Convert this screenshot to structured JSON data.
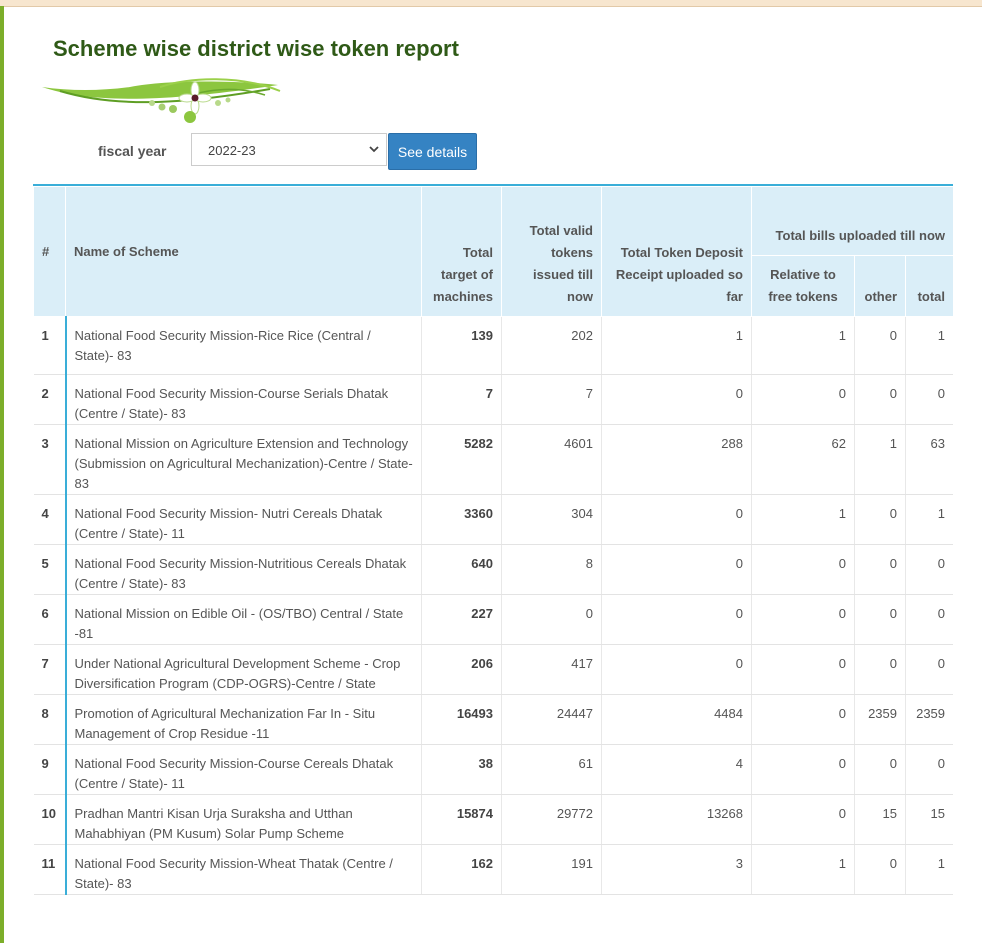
{
  "page": {
    "title": "Scheme wise district wise token report"
  },
  "filter": {
    "label": "fiscal year",
    "selected": "2022-23",
    "button_label": "See details"
  },
  "table": {
    "headers": {
      "index": "#",
      "name": "Name of Scheme",
      "target": "Total target of machines",
      "valid_tokens": "Total valid tokens issued till now",
      "deposit": "Total Token Deposit Receipt uploaded so far",
      "bills_group": "Total bills uploaded till now",
      "relative": "Relative to free tokens",
      "other": "other",
      "total": "total"
    },
    "rows": [
      {
        "idx": "1",
        "name": "National Food Security Mission-Rice Rice (Central / State)- 83",
        "target": "139",
        "valid": "202",
        "deposit": "1",
        "relative": "1",
        "other": "0",
        "total": "1"
      },
      {
        "idx": "2",
        "name": "National Food Security Mission-Course Serials Dhatak (Centre / State)- 83",
        "target": "7",
        "valid": "7",
        "deposit": "0",
        "relative": "0",
        "other": "0",
        "total": "0"
      },
      {
        "idx": "3",
        "name": "National Mission on Agriculture Extension and Technology (Submission on Agricultural Mechanization)-Centre / State- 83",
        "target": "5282",
        "valid": "4601",
        "deposit": "288",
        "relative": "62",
        "other": "1",
        "total": "63"
      },
      {
        "idx": "4",
        "name": "National Food Security Mission- Nutri Cereals Dhatak (Centre / State)- 11",
        "target": "3360",
        "valid": "304",
        "deposit": "0",
        "relative": "1",
        "other": "0",
        "total": "1"
      },
      {
        "idx": "5",
        "name": "National Food Security Mission-Nutritious Cereals Dhatak (Centre / State)- 83",
        "target": "640",
        "valid": "8",
        "deposit": "0",
        "relative": "0",
        "other": "0",
        "total": "0"
      },
      {
        "idx": "6",
        "name": "National Mission on Edible Oil - (OS/TBO) Central / State -81",
        "target": "227",
        "valid": "0",
        "deposit": "0",
        "relative": "0",
        "other": "0",
        "total": "0"
      },
      {
        "idx": "7",
        "name": "Under National Agricultural Development Scheme - Crop Diversification Program (CDP-OGRS)-Centre / State",
        "target": "206",
        "valid": "417",
        "deposit": "0",
        "relative": "0",
        "other": "0",
        "total": "0"
      },
      {
        "idx": "8",
        "name": "Promotion of Agricultural Mechanization Far In - Situ Management of Crop Residue -11",
        "target": "16493",
        "valid": "24447",
        "deposit": "4484",
        "relative": "0",
        "other": "2359",
        "total": "2359"
      },
      {
        "idx": "9",
        "name": "National Food Security Mission-Course Cereals Dhatak (Centre / State)- 11",
        "target": "38",
        "valid": "61",
        "deposit": "4",
        "relative": "0",
        "other": "0",
        "total": "0"
      },
      {
        "idx": "10",
        "name": "Pradhan Mantri Kisan Urja Suraksha and Utthan Mahabhiyan (PM Kusum) Solar Pump Scheme",
        "target": "15874",
        "valid": "29772",
        "deposit": "13268",
        "relative": "0",
        "other": "15",
        "total": "15"
      },
      {
        "idx": "11",
        "name": "National Food Security Mission-Wheat Thatak (Centre / State)- 83",
        "target": "162",
        "valid": "191",
        "deposit": "3",
        "relative": "1",
        "other": "0",
        "total": "1"
      }
    ]
  }
}
